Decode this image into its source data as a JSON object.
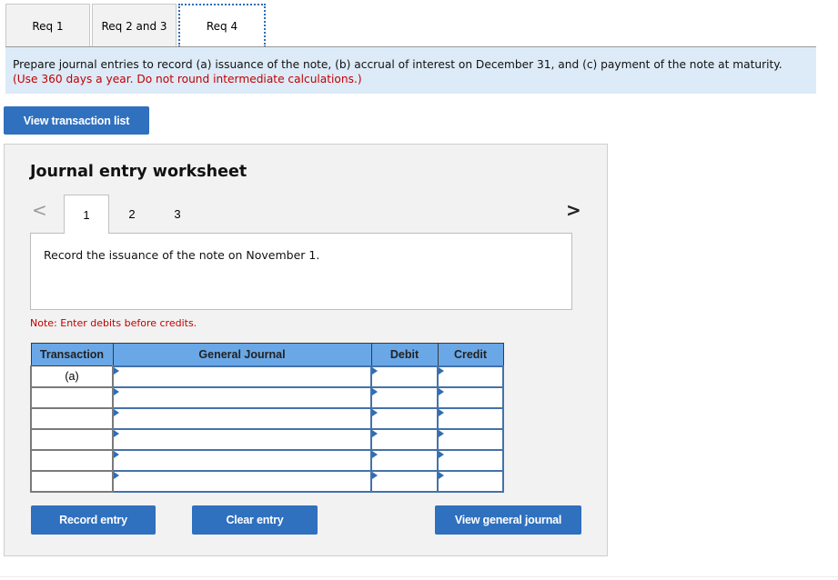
{
  "tabs": [
    {
      "label": "Req 1",
      "active": false
    },
    {
      "label": "Req 2 and 3",
      "active": false
    },
    {
      "label": "Req 4",
      "active": true
    }
  ],
  "instructions": {
    "text": "Prepare journal entries to record (a) issuance of the note, (b) accrual of interest on December 31, and (c) payment of the note at maturity.",
    "note": "(Use 360 days a year. Do not round intermediate calculations.)"
  },
  "buttons": {
    "view_transaction_list": "View transaction list",
    "record_entry": "Record entry",
    "clear_entry": "Clear entry",
    "view_general_journal": "View general journal"
  },
  "worksheet": {
    "title": "Journal entry worksheet",
    "prev_icon": "chevron-left-icon",
    "next_icon": "chevron-right-icon",
    "prev_glyph": "<",
    "next_glyph": ">",
    "steps": [
      "1",
      "2",
      "3"
    ],
    "active_step": "1",
    "description": "Record the issuance of the note on November 1.",
    "note": "Note: Enter debits before credits."
  },
  "journal_table": {
    "headers": {
      "transaction": "Transaction",
      "general_journal": "General Journal",
      "debit": "Debit",
      "credit": "Credit"
    },
    "rows": [
      {
        "transaction": "(a)",
        "account": "",
        "debit": "",
        "credit": ""
      },
      {
        "transaction": "",
        "account": "",
        "debit": "",
        "credit": ""
      },
      {
        "transaction": "",
        "account": "",
        "debit": "",
        "credit": ""
      },
      {
        "transaction": "",
        "account": "",
        "debit": "",
        "credit": ""
      },
      {
        "transaction": "",
        "account": "",
        "debit": "",
        "credit": ""
      },
      {
        "transaction": "",
        "account": "",
        "debit": "",
        "credit": ""
      }
    ]
  },
  "colors": {
    "accent": "#2f70bf",
    "banner_bg": "#dcebf7",
    "note_red": "#c00000",
    "table_header": "#6aa7e6"
  }
}
